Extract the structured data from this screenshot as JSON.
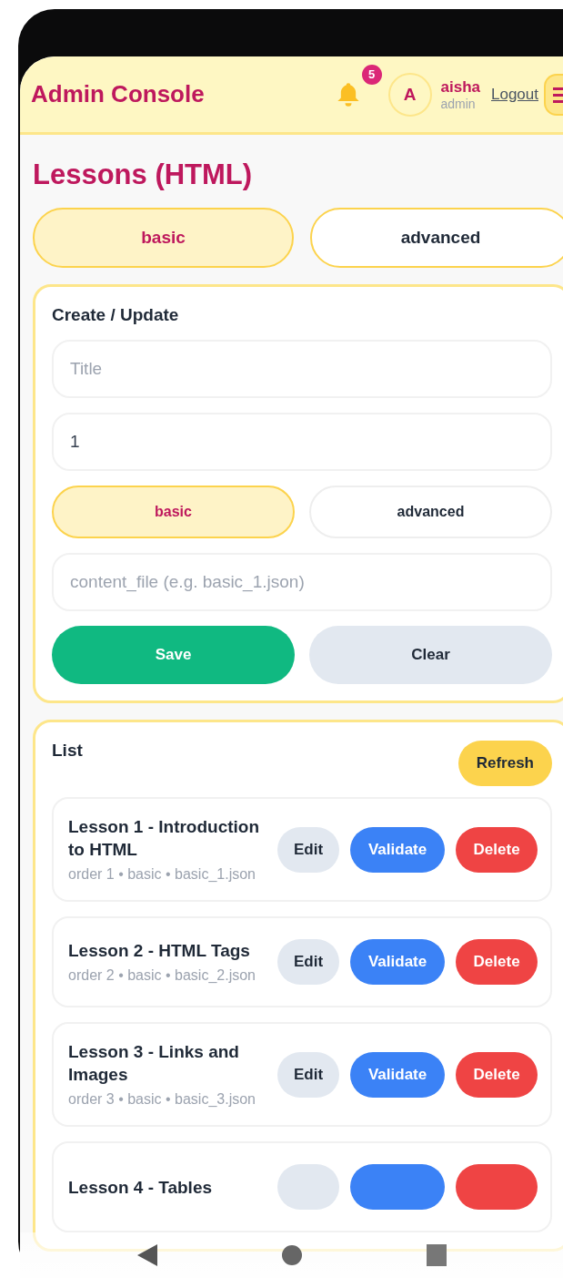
{
  "header": {
    "title": "Admin Console",
    "notification_count": "5",
    "avatar_letter": "A",
    "user_name": "aisha",
    "user_role": "admin",
    "logout": "Logout"
  },
  "page_title": "Lessons (HTML)",
  "level_tabs": [
    {
      "label": "basic",
      "selected": true
    },
    {
      "label": "advanced",
      "selected": false
    }
  ],
  "form": {
    "title": "Create / Update",
    "title_field": {
      "placeholder": "Title"
    },
    "order_field": {
      "value": "1"
    },
    "level_options": [
      {
        "label": "basic",
        "selected": true
      },
      {
        "label": "advanced",
        "selected": false
      }
    ],
    "content_file_field": {
      "placeholder": "content_file (e.g. basic_1.json)"
    },
    "buttons": [
      {
        "label": "Save",
        "kind": "primary"
      },
      {
        "label": "Clear",
        "kind": "secondary"
      }
    ]
  },
  "list": {
    "title": "List",
    "refresh": "Refresh",
    "lessons": [
      {
        "title": "Lesson 1 - Introduction to HTML",
        "meta": "order 1 • basic • basic_1.json",
        "actions": [
          {
            "label": "Edit",
            "kind": "edit"
          },
          {
            "label": "Validate",
            "kind": "validate"
          },
          {
            "label": "Delete",
            "kind": "delete"
          }
        ]
      },
      {
        "title": "Lesson 2 - HTML Tags",
        "meta": "order 2 • basic • basic_2.json",
        "actions": [
          {
            "label": "Edit",
            "kind": "edit"
          },
          {
            "label": "Validate",
            "kind": "validate"
          },
          {
            "label": "Delete",
            "kind": "delete"
          }
        ]
      },
      {
        "title": "Lesson 3 - Links and Images",
        "meta": "order 3 • basic • basic_3.json",
        "actions": [
          {
            "label": "Edit",
            "kind": "edit"
          },
          {
            "label": "Validate",
            "kind": "validate"
          },
          {
            "label": "Delete",
            "kind": "delete"
          }
        ]
      },
      {
        "title": "Lesson 4 - Tables",
        "actions": [
          {
            "kind": "edit"
          },
          {
            "kind": "validate"
          },
          {
            "kind": "delete"
          }
        ]
      }
    ]
  }
}
